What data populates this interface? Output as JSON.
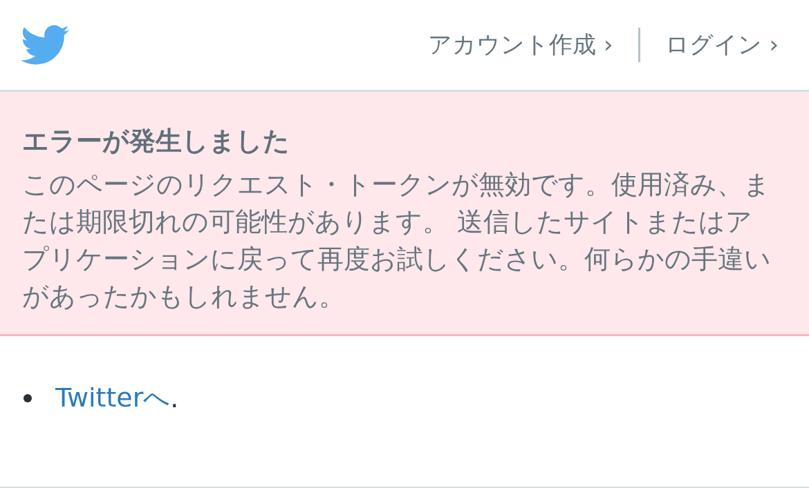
{
  "header": {
    "links": [
      {
        "label": "アカウント作成 ›"
      },
      {
        "label": "ログイン ›"
      }
    ]
  },
  "error": {
    "title": "エラーが発生しました",
    "message": "このページのリクエスト・トークンが無効です。使用済み、または期限切れの可能性があります。 送信したサイトまたはアプリケーションに戻って再度お試しください。何らかの手違いがあったかもしれません。"
  },
  "links": [
    {
      "label": "Twitterへ",
      "suffix": "."
    }
  ]
}
